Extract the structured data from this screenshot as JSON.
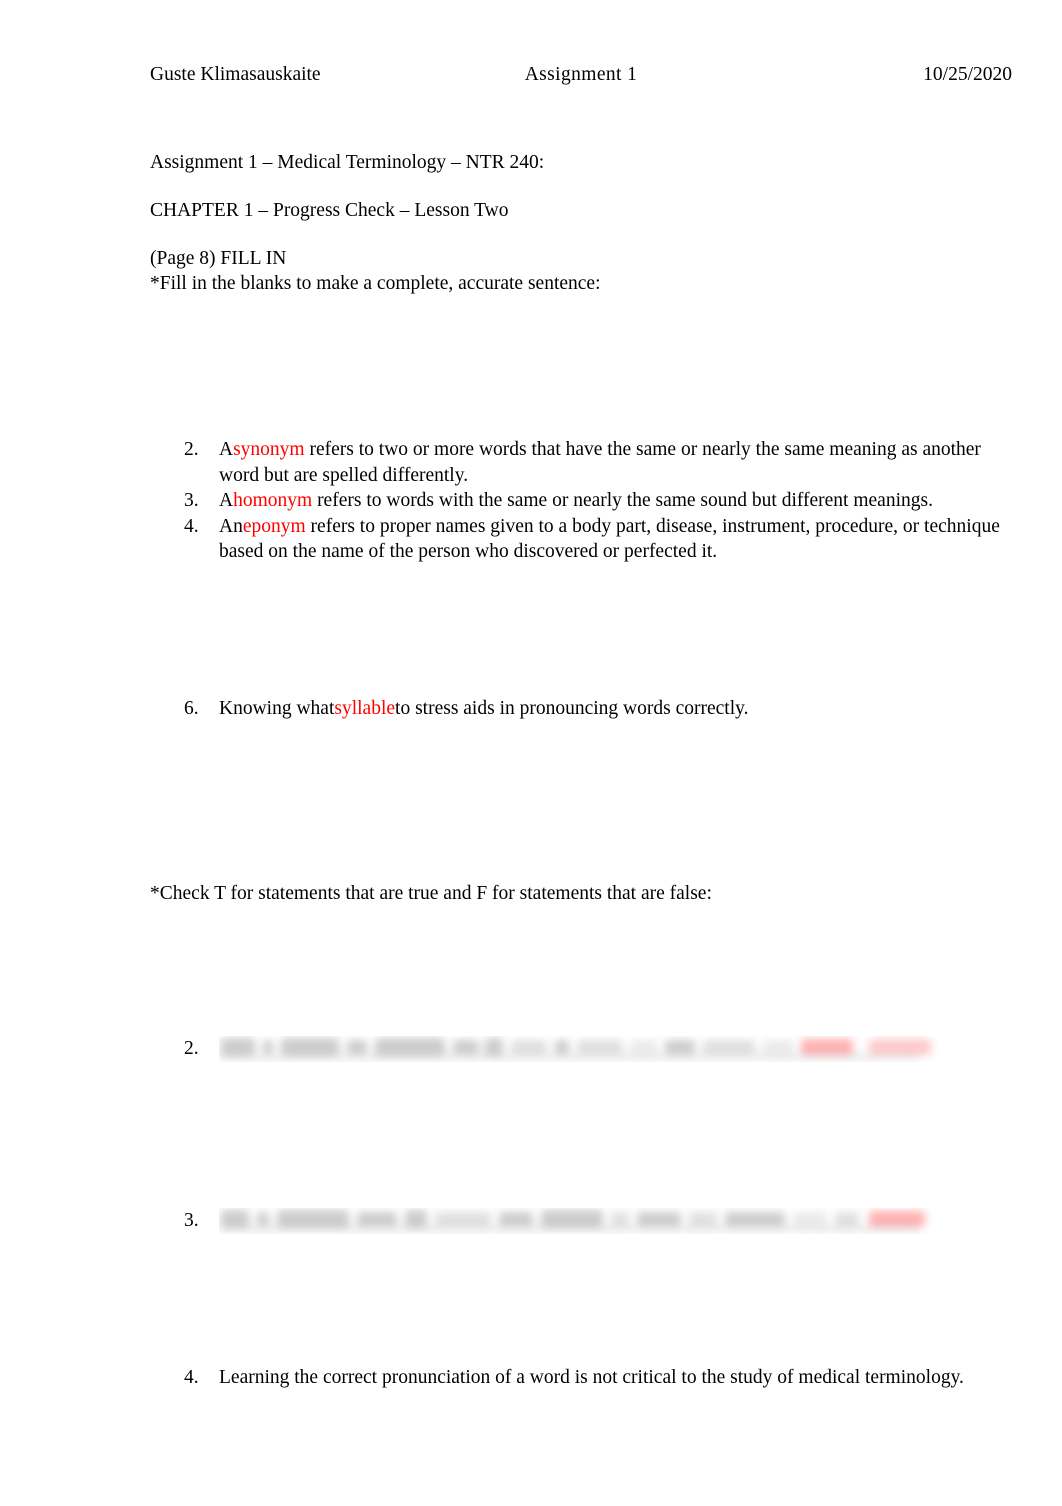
{
  "document": {
    "header": {
      "student_name": "Guste Klimasauskaite",
      "assignment": "Assignment 1",
      "date": "10/25/2020"
    },
    "title": "Assignment 1 – Medical Terminology – NTR 240:",
    "chapter": "CHAPTER 1 – Progress Check – Lesson Two",
    "page_ref": "(Page 8) FILL IN",
    "fill_instruction": "*Fill in the blanks to make a complete, accurate sentence:",
    "check_instruction": "*Check T for statements that are true and F for statements that are false:",
    "colors": {
      "answer_highlight": "#ff0000",
      "text": "#000000",
      "page_background": "#ffffff"
    },
    "fill_in_items": [
      {
        "number": "2.",
        "lead": "A",
        "answer": "synonym",
        "tail": " refers to two or more words that have the same or nearly the same meaning as another word but are spelled differently."
      },
      {
        "number": "3.",
        "lead": "A",
        "answer": "homonym",
        "tail": " refers to words with the same or nearly the same sound but different meanings."
      },
      {
        "number": "4.",
        "lead": "An",
        "answer": "eponym ",
        "tail": "refers to proper names given to a body part, disease, instrument, procedure, or technique based on the name of the person who discovered or perfected it."
      }
    ],
    "syllable_item": {
      "number": "6.",
      "lead": "Knowing what",
      "answer": "syllable",
      "tail": "to stress aids in pronouncing words correctly."
    },
    "true_false_items": [
      {
        "number": "2.",
        "text": "",
        "redacted": true
      },
      {
        "number": "3.",
        "text": "",
        "redacted": true
      },
      {
        "number": "4.",
        "text": "Learning the correct pronunciation of a word is not critical to the study of medical terminology.",
        "redacted": false
      }
    ]
  }
}
